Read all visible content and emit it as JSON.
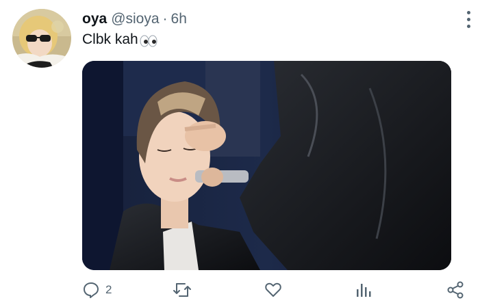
{
  "tweet": {
    "display_name": "oya",
    "handle": "@sioya",
    "separator": "·",
    "time": "6h",
    "text": "Clbk kah",
    "text_emoji": "eyes-emoji"
  },
  "actions": {
    "reply_count": "2",
    "icons": [
      "reply-icon",
      "retweet-icon",
      "like-icon",
      "analytics-icon",
      "share-icon"
    ]
  },
  "colors": {
    "text_primary": "#0f1419",
    "text_secondary": "#536471",
    "background": "#ffffff"
  }
}
